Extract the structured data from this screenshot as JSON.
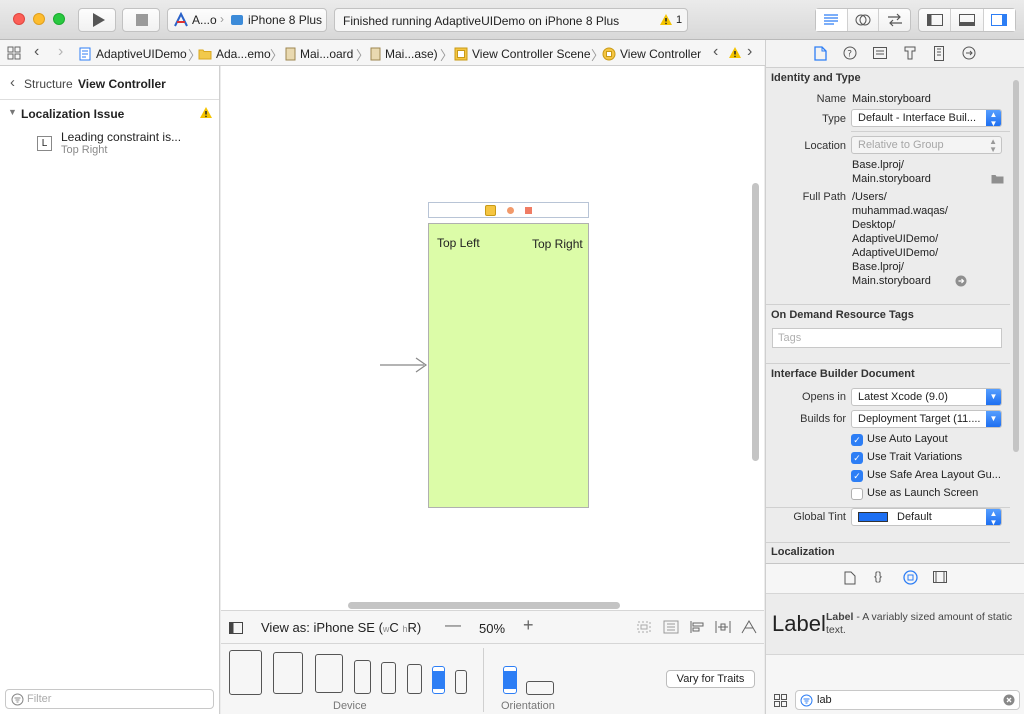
{
  "toolbar": {
    "scheme_app": "A...o",
    "scheme_device": "iPhone 8 Plus",
    "status_text": "Finished running AdaptiveUIDemo on iPhone 8 Plus",
    "warning_count": "1"
  },
  "jumpbar": {
    "crumbs": [
      "AdaptiveUIDemo",
      "Ada...emo",
      "Mai...oard",
      "Mai...ase)",
      "View Controller Scene",
      "View Controller"
    ]
  },
  "outline": {
    "back_label": "Structure",
    "title": "View Controller",
    "issue_group": "Localization Issue",
    "issue_title": "Leading constraint is...",
    "issue_subtitle": "Top Right",
    "issue_icon_letter": "L",
    "filter_placeholder": "Filter"
  },
  "canvas": {
    "label_left": "Top Left",
    "label_right": "Top Right",
    "view_bg": "#dcfca8"
  },
  "device_bar": {
    "view_as": "View as: iPhone SE",
    "size_class_w": "w",
    "size_class_c": "C",
    "size_class_h": "h",
    "size_class_r": "R)",
    "view_as_paren": "(",
    "zoom": "50%",
    "device_caption": "Device",
    "orientation_caption": "Orientation",
    "vary_button": "Vary for Traits"
  },
  "inspector": {
    "identity_title": "Identity and Type",
    "name_label": "Name",
    "name_value": "Main.storyboard",
    "type_label": "Type",
    "type_value": "Default - Interface Buil...",
    "location_label": "Location",
    "location_value": "Relative to Group",
    "location_path": [
      "Base.lproj/",
      "Main.storyboard"
    ],
    "fullpath_label": "Full Path",
    "fullpath_lines": [
      "/Users/",
      "muhammad.waqas/",
      "Desktop/",
      "AdaptiveUIDemo/",
      "AdaptiveUIDemo/",
      "Base.lproj/",
      "Main.storyboard"
    ],
    "ondemand_title": "On Demand Resource Tags",
    "tags_placeholder": "Tags",
    "ibdoc_title": "Interface Builder Document",
    "opens_label": "Opens in",
    "opens_value": "Latest Xcode (9.0)",
    "builds_label": "Builds for",
    "builds_value": "Deployment Target (11....",
    "checks": [
      {
        "label": "Use Auto Layout",
        "on": true
      },
      {
        "label": "Use Trait Variations",
        "on": true
      },
      {
        "label": "Use Safe Area Layout Gu...",
        "on": true
      },
      {
        "label": "Use as Launch Screen",
        "on": false
      }
    ],
    "tint_label": "Global Tint",
    "tint_value": "Default",
    "tint_color": "#1d6ff2",
    "localization_title": "Localization"
  },
  "library": {
    "item_title": "Label",
    "item_name": "Label",
    "item_desc": " - A variably sized amount of static text.",
    "search_value": "lab"
  },
  "colors": {
    "accent": "#2d7ef5",
    "warning": "#f5c400"
  }
}
